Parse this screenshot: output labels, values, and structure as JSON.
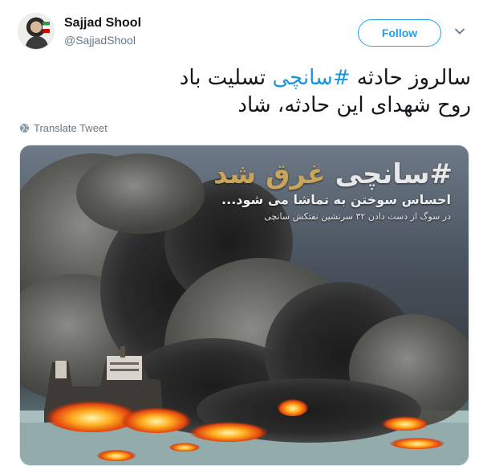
{
  "user": {
    "display_name": "Sajjad Shool",
    "handle": "@SajjadShool"
  },
  "actions": {
    "follow_label": "Follow",
    "more_icon": "chevron-down-icon"
  },
  "tweet": {
    "line1_before": "سالروز حادثه ",
    "hashtag": "#سانچی",
    "line1_after": " تسلیت باد",
    "line2": "روح شهدای این حادثه، شاد"
  },
  "translate": {
    "label": "Translate Tweet",
    "icon": "globe-icon"
  },
  "media": {
    "headline_hashtag": "#سانچی",
    "headline_rest": " غرق شد",
    "subtitle": "احساس سوختن به تماشا می شود...",
    "caption": "در سوگ از دست دادن ۳۲ سرنشین نفتکش سانچی"
  },
  "colors": {
    "accent": "#1da1f2",
    "hashtag": "#1b95e0",
    "secondary_text": "#657786"
  }
}
